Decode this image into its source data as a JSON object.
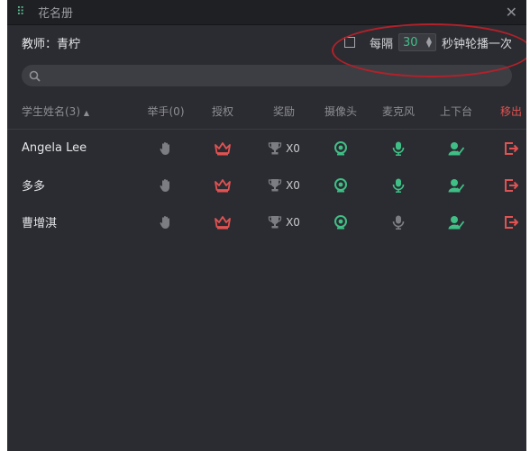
{
  "window": {
    "title": "花名册"
  },
  "toolbar": {
    "teacher": "教师：青柠",
    "every_label": "每隔",
    "interval_value": "30",
    "suffix_label": "秒钟轮播一次"
  },
  "search": {
    "placeholder": ""
  },
  "table": {
    "headers": {
      "name": "学生姓名(3)",
      "hands": "举手(0)",
      "authorize": "授权",
      "award": "奖励",
      "camera": "摄像头",
      "mic": "麦克风",
      "stage": "上下台",
      "remove": "移出"
    },
    "rows": [
      {
        "name": "Angela Lee",
        "award_count": "X0",
        "mic_enabled": true
      },
      {
        "name": "多多",
        "award_count": "X0",
        "mic_enabled": true
      },
      {
        "name": "曹增淇",
        "award_count": "X0",
        "mic_enabled": false
      }
    ]
  },
  "colors": {
    "green": "#3fbf86",
    "red": "#e25252",
    "gray": "#7c7d83",
    "background": "#2b2c31"
  },
  "icons": [
    "grip-icon",
    "close-icon",
    "search-icon",
    "hand-icon",
    "crown-icon",
    "trophy-icon",
    "camera-icon",
    "mic-icon",
    "stage-icon",
    "exit-icon"
  ]
}
